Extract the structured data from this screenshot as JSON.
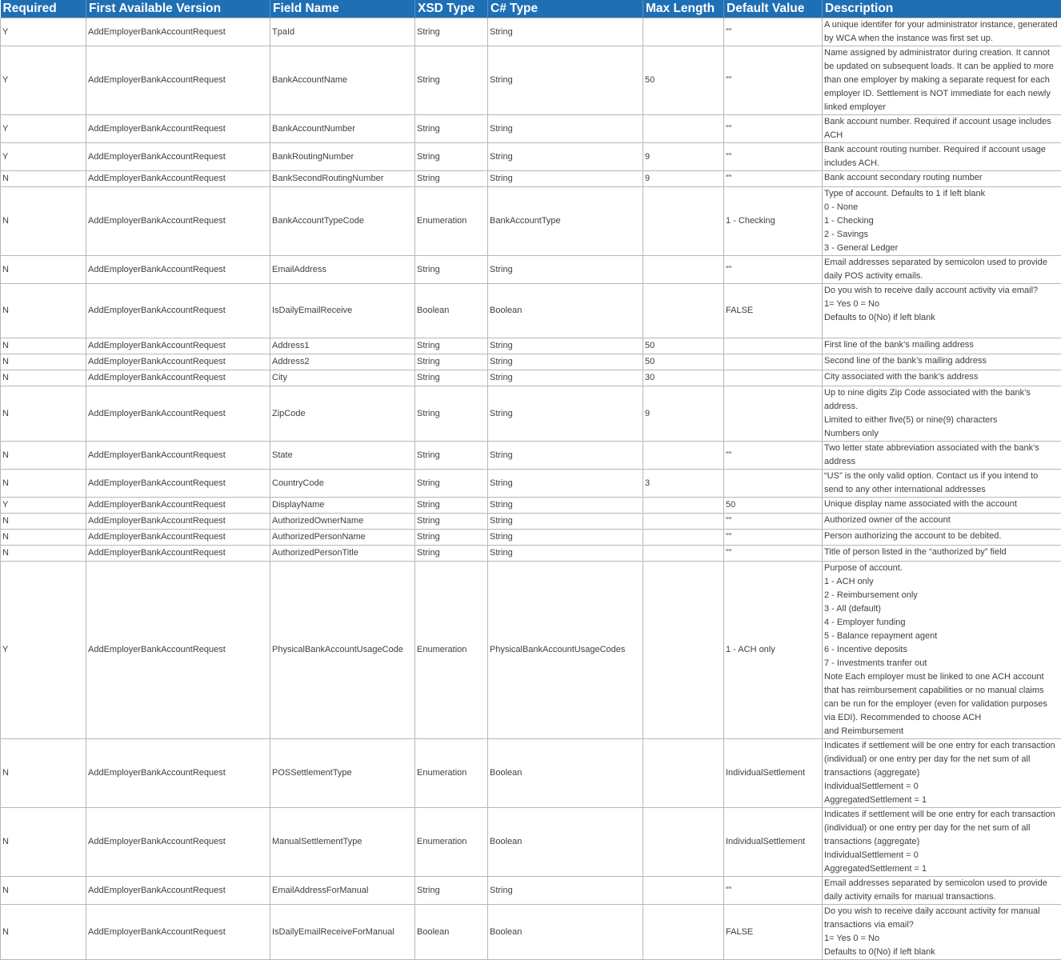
{
  "columns": [
    "Required",
    "First Available Version",
    "Field Name",
    "XSD Type",
    "C# Type",
    "Max Length",
    "Default Value",
    "Description"
  ],
  "rows": [
    {
      "required": "Y",
      "version": "AddEmployerBankAccountRequest",
      "field": "TpaId",
      "xsd": "String",
      "cs": "String",
      "max": "",
      "def": "””",
      "desc": "A unique identifer for your administrator instance, generated by WCA when the instance was first set up."
    },
    {
      "required": "Y",
      "version": "AddEmployerBankAccountRequest",
      "field": "BankAccountName",
      "xsd": "String",
      "cs": "String",
      "max": "50",
      "def": "””",
      "desc": "Name assigned by administrator during creation. It cannot be updated on subsequent loads. It can be applied to more than one employer by making a separate request for each employer ID. Settlement is NOT immediate for each newly linked employer"
    },
    {
      "required": "Y",
      "version": "AddEmployerBankAccountRequest",
      "field": "BankAccountNumber",
      "xsd": "String",
      "cs": "String",
      "max": "",
      "def": "””",
      "desc": "Bank account number. Required if account usage includes ACH"
    },
    {
      "required": "Y",
      "version": "AddEmployerBankAccountRequest",
      "field": "BankRoutingNumber",
      "xsd": "String",
      "cs": "String",
      "max": "9",
      "def": "””",
      "desc": "Bank account routing number. Required if account usage includes ACH."
    },
    {
      "required": "N",
      "version": "AddEmployerBankAccountRequest",
      "field": "BankSecondRoutingNumber",
      "xsd": "String",
      "cs": "String",
      "max": "9",
      "def": "””",
      "desc": "Bank account secondary routing number"
    },
    {
      "required": "N",
      "version": "AddEmployerBankAccountRequest",
      "field": "BankAccountTypeCode",
      "xsd": "Enumeration",
      "cs": "BankAccountType",
      "max": "",
      "def": "1 - Checking",
      "desc": "Type of account. Defaults to 1 if left blank\n0 - None\n1 - Checking\n2 - Savings\n3 - General Ledger"
    },
    {
      "required": "N",
      "version": "AddEmployerBankAccountRequest",
      "field": "EmailAddress",
      "xsd": "String",
      "cs": "String",
      "max": "",
      "def": "””",
      "desc": "Email addresses separated by semicolon used to provide daily POS activity emails."
    },
    {
      "required": "N",
      "version": "AddEmployerBankAccountRequest",
      "field": "IsDailyEmailReceive",
      "xsd": "Boolean",
      "cs": "Boolean",
      "max": "",
      "def": "FALSE",
      "desc": "Do you wish to receive daily account activity via email?\n1= Yes 0 = No\nDefaults to 0(No) if left blank"
    },
    {
      "required": "N",
      "version": "AddEmployerBankAccountRequest",
      "field": "Address1",
      "xsd": "String",
      "cs": "String",
      "max": "50",
      "def": "",
      "desc": "First line of the bank’s mailing address"
    },
    {
      "required": "N",
      "version": "AddEmployerBankAccountRequest",
      "field": "Address2",
      "xsd": "String",
      "cs": "String",
      "max": "50",
      "def": "",
      "desc": "Second line of the bank’s mailing address"
    },
    {
      "required": "N",
      "version": "AddEmployerBankAccountRequest",
      "field": "City",
      "xsd": "String",
      "cs": "String",
      "max": "30",
      "def": "",
      "desc": "City associated with the bank’s address"
    },
    {
      "required": "N",
      "version": "AddEmployerBankAccountRequest",
      "field": "ZipCode",
      "xsd": "String",
      "cs": "String",
      "max": "9",
      "def": "",
      "desc": "Up to nine digits Zip Code associated with the bank’s address.\nLimited to either five(5) or nine(9) characters\nNumbers only"
    },
    {
      "required": "N",
      "version": "AddEmployerBankAccountRequest",
      "field": "State",
      "xsd": "String",
      "cs": "String",
      "max": "",
      "def": "””",
      "desc": "Two letter state abbreviation associated with the bank’s address"
    },
    {
      "required": "N",
      "version": "AddEmployerBankAccountRequest",
      "field": "CountryCode",
      "xsd": "String",
      "cs": "String",
      "max": "3",
      "def": "",
      "desc": "“US” is the only valid option. Contact us if you intend to send to any other international addresses"
    },
    {
      "required": "Y",
      "version": "AddEmployerBankAccountRequest",
      "field": "DisplayName",
      "xsd": "String",
      "cs": "String",
      "max": "",
      "def": "50",
      "desc": "Unique display name associated with the account"
    },
    {
      "required": "N",
      "version": "AddEmployerBankAccountRequest",
      "field": "AuthorizedOwnerName",
      "xsd": "String",
      "cs": "String",
      "max": "",
      "def": "””",
      "desc": "Authorized owner of the account"
    },
    {
      "required": "N",
      "version": "AddEmployerBankAccountRequest",
      "field": "AuthorizedPersonName",
      "xsd": "String",
      "cs": "String",
      "max": "",
      "def": "””",
      "desc": "Person authorizing the account to be debited."
    },
    {
      "required": "N",
      "version": "AddEmployerBankAccountRequest",
      "field": "AuthorizedPersonTitle",
      "xsd": "String",
      "cs": "String",
      "max": "",
      "def": "””",
      "desc": "Title of person listed in the “authorized by” field"
    },
    {
      "required": "Y",
      "version": "AddEmployerBankAccountRequest",
      "field": "PhysicalBankAccountUsageCode",
      "xsd": "Enumeration",
      "cs": "PhysicalBankAccountUsageCodes",
      "max": "",
      "def": "1 - ACH only",
      "desc": "Purpose of account.\n1 - ACH only\n2 - Reimbursement only\n3 - All (default)\n4 - Employer funding\n5 - Balance repayment agent\n6 - Incentive deposits\n7 - Investments tranfer out\nNote Each employer must be linked to one ACH account that has reimbursement capabilities or no manual claims can be run for the employer (even for validation purposes via EDI). Recommended to choose ACH\nand Reimbursement"
    },
    {
      "required": "N",
      "version": "AddEmployerBankAccountRequest",
      "field": "POSSettlementType",
      "xsd": "Enumeration",
      "cs": "Boolean",
      "max": "",
      "def": "IndividualSettlement",
      "desc": "Indicates if settlement will be one entry for each transaction (individual) or one entry per day for the net sum of all transactions (aggregate)\nIndividualSettlement = 0\nAggregatedSettlement = 1"
    },
    {
      "required": "N",
      "version": "AddEmployerBankAccountRequest",
      "field": "ManualSettlementType",
      "xsd": "Enumeration",
      "cs": "Boolean",
      "max": "",
      "def": "IndividualSettlement",
      "desc": "Indicates if settlement will be one entry for each transaction (individual) or one entry per day for the net sum of all transactions (aggregate)\nIndividualSettlement = 0\nAggregatedSettlement = 1"
    },
    {
      "required": "N",
      "version": "AddEmployerBankAccountRequest",
      "field": "EmailAddressForManual",
      "xsd": "String",
      "cs": "String",
      "max": "",
      "def": "””",
      "desc": "Email addresses separated by semicolon used to provide daily activity emails for manual transactions."
    },
    {
      "required": "N",
      "version": "AddEmployerBankAccountRequest",
      "field": "IsDailyEmailReceiveForManual",
      "xsd": "Boolean",
      "cs": "Boolean",
      "max": "",
      "def": "FALSE",
      "desc": "Do you wish to receive daily account activity for manual transactions via email?\n1= Yes 0 = No\nDefaults to 0(No) if left blank"
    }
  ]
}
